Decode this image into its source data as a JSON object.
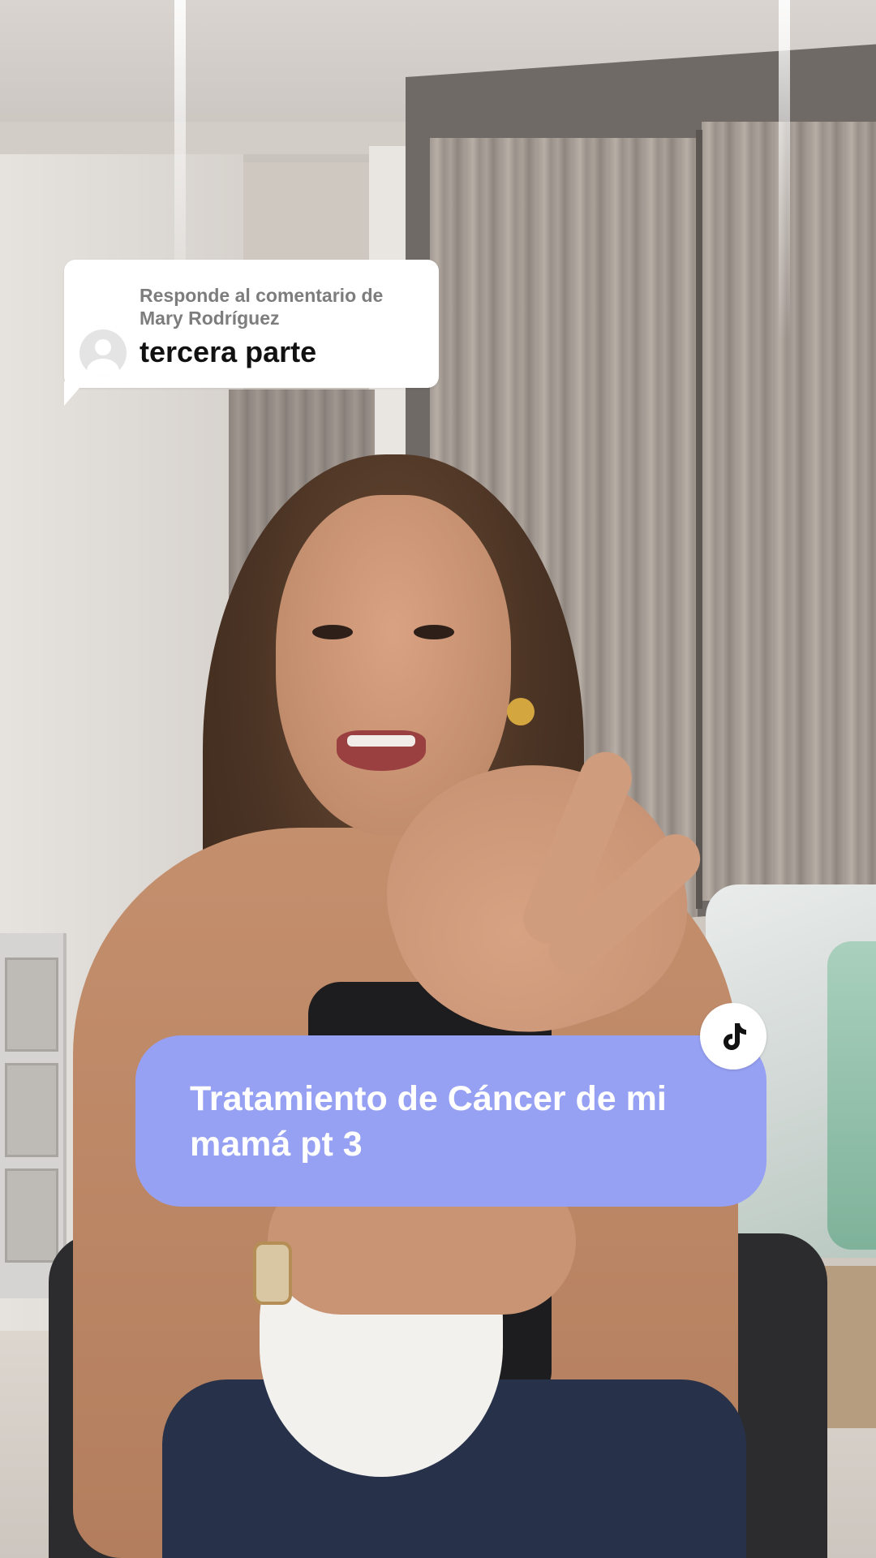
{
  "reply_bubble": {
    "header": "Responde al comentario de Mary Rodríguez",
    "comment": "tercera parte",
    "avatar_icon": "default-avatar-icon"
  },
  "caption": {
    "text": "Tratamiento de Cáncer de mi mamá pt 3",
    "background_color": "#97a1f3",
    "badge_icon": "tiktok-logo-icon"
  }
}
